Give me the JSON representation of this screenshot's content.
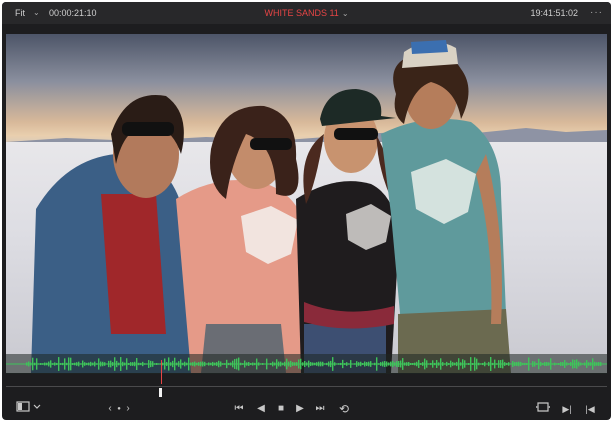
{
  "topbar": {
    "zoom_label": "Fit",
    "zoom_chevron": "⌄",
    "source_timecode": "00:00:21:10",
    "clip_title": "WHITE SANDS 11",
    "clip_chevron": "⌄",
    "record_timecode": "19:41:51:02",
    "more_label": "···"
  },
  "transport": {
    "viewer_mode_icon": "viewer-mode-icon",
    "nav_prev": "‹",
    "nav_dot": "●",
    "nav_next": "›",
    "first_frame": "⏮",
    "play_reverse": "◀",
    "stop": "■",
    "play_forward": "▶",
    "last_frame": "⏭",
    "loop": "⟲",
    "match_frame_icon": "match-frame-icon",
    "mark_in": "▶|",
    "mark_out": "|◀"
  },
  "colors": {
    "accent_red": "#e64545",
    "waveform_green": "#3ec45a",
    "bar_bg": "#28282a"
  }
}
